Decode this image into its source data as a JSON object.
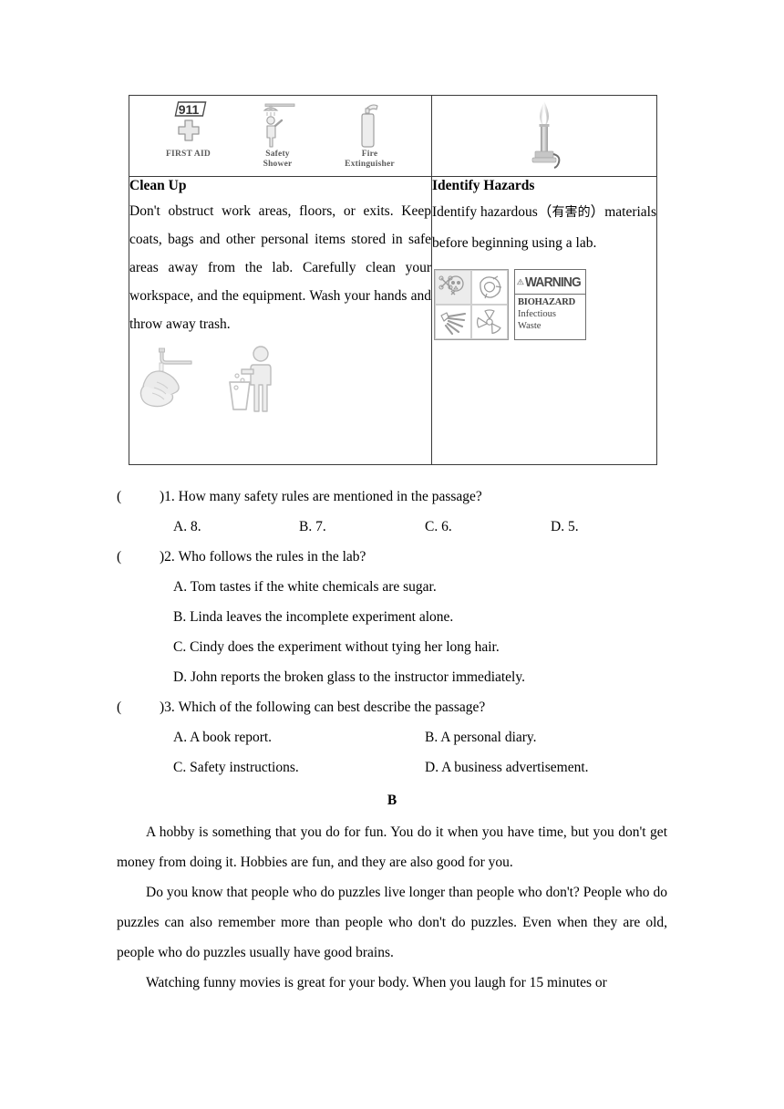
{
  "table": {
    "left_cell": {
      "icons": [
        {
          "name": "first-aid-icon",
          "badge": "911",
          "caption": "FIRST AID"
        },
        {
          "name": "safety-shower-icon",
          "caption_line1": "Safety",
          "caption_line2": "Shower"
        },
        {
          "name": "fire-extinguisher-icon",
          "caption_line1": "Fire",
          "caption_line2": "Extinguisher"
        }
      ],
      "title": "Clean Up",
      "body": "Don't obstruct work areas, floors, or exits. Keep coats, bags and other personal items stored in safe areas away from the lab. Carefully clean your workspace, and the equipment. Wash your hands and throw away trash.",
      "bottom_icons": [
        "wash-hands-icon",
        "throw-trash-icon"
      ]
    },
    "right_cell": {
      "icon": "bunsen-burner-icon",
      "title": "Identify Hazards",
      "body_part1": "Identify hazardous（",
      "body_chinese": "有害的",
      "body_part2": "）materials before beginning using a lab.",
      "hazard_icons": [
        "skull-crossbones-icon",
        "corrosive-icon",
        "explosive-icon",
        "radioactive-icon"
      ],
      "warning_label": {
        "heading": "WARNING",
        "line1": "BIOHAZARD",
        "line2": "Infectious",
        "line3": "Waste"
      }
    }
  },
  "questions": [
    {
      "marker": "(",
      "close": ")",
      "number": "1.",
      "text": "How many safety rules are mentioned in the passage?",
      "layout": "four",
      "options": [
        "A. 8.",
        "B. 7.",
        "C. 6.",
        "D. 5."
      ]
    },
    {
      "marker": "(",
      "close": ")",
      "number": "2.",
      "text": "Who follows the rules in the lab?",
      "layout": "stacked",
      "options": [
        "A. Tom tastes if the white chemicals are sugar.",
        "B. Linda leaves the incomplete experiment alone.",
        "C. Cindy does the experiment without tying her long hair.",
        "D. John reports the broken glass to the instructor immediately."
      ]
    },
    {
      "marker": "(",
      "close": ")",
      "number": "3.",
      "text": "Which of the following can best describe the passage?",
      "layout": "two",
      "options": [
        "A. A book report.",
        "B. A personal diary.",
        "C. Safety instructions.",
        "D. A business advertisement."
      ]
    }
  ],
  "section_b": {
    "label": "B",
    "paragraphs": [
      "A hobby is something that you do for fun. You do it when you have time, but you don't get money from doing it. Hobbies are fun, and they are also good for you.",
      "Do you know that people who do puzzles live longer than people who don't? People who do puzzles can also remember more than people who don't do puzzles. Even when they are old, people who do puzzles usually have good brains.",
      "Watching funny movies is great for your body. When you laugh for 15 minutes or"
    ]
  },
  "colors": {
    "text": "#000000",
    "table_border": "#3a3a3a",
    "icon_gray": "#9a9a9a",
    "caption_gray": "#5a5a5a"
  }
}
